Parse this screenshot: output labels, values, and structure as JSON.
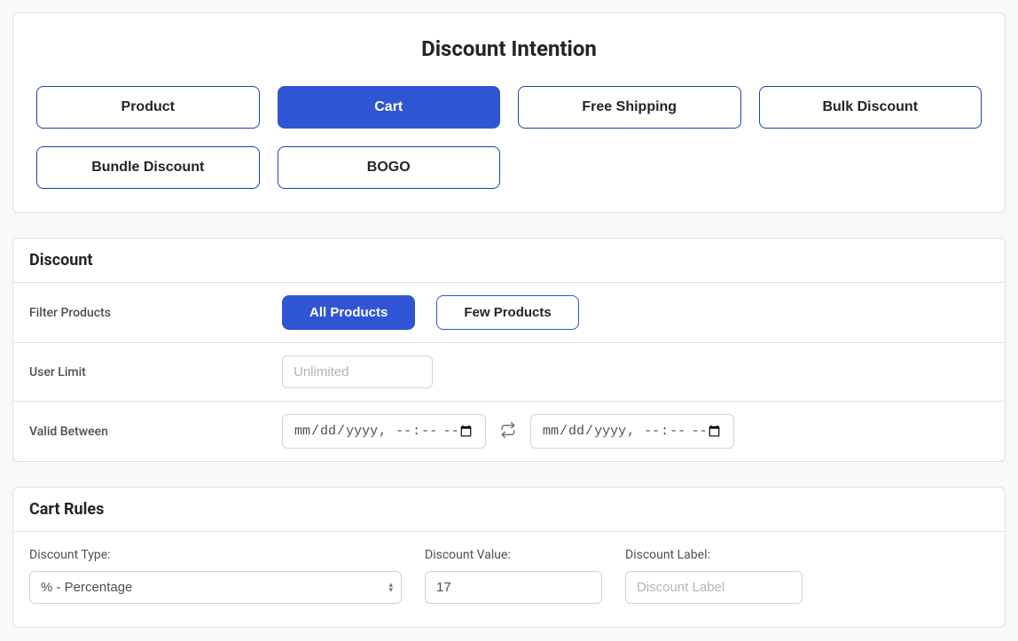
{
  "intention": {
    "title": "Discount Intention",
    "options": [
      "Product",
      "Cart",
      "Free Shipping",
      "Bulk Discount",
      "Bundle Discount",
      "BOGO"
    ],
    "active": "Cart"
  },
  "discount": {
    "title": "Discount",
    "filter": {
      "label": "Filter Products",
      "options": [
        "All Products",
        "Few Products"
      ],
      "active": "All Products"
    },
    "user_limit": {
      "label": "User Limit",
      "placeholder": "Unlimited",
      "value": ""
    },
    "valid": {
      "label": "Valid Between",
      "from_placeholder": "mm/dd/yyyy --:-- --",
      "to_placeholder": "mm/dd/yyyy --:-- --"
    }
  },
  "rules": {
    "title": "Cart Rules",
    "type": {
      "label": "Discount Type:",
      "selected": "% - Percentage"
    },
    "value": {
      "label": "Discount Value:",
      "value": "17"
    },
    "dlabel": {
      "label": "Discount Label:",
      "placeholder": "Discount Label",
      "value": ""
    }
  }
}
